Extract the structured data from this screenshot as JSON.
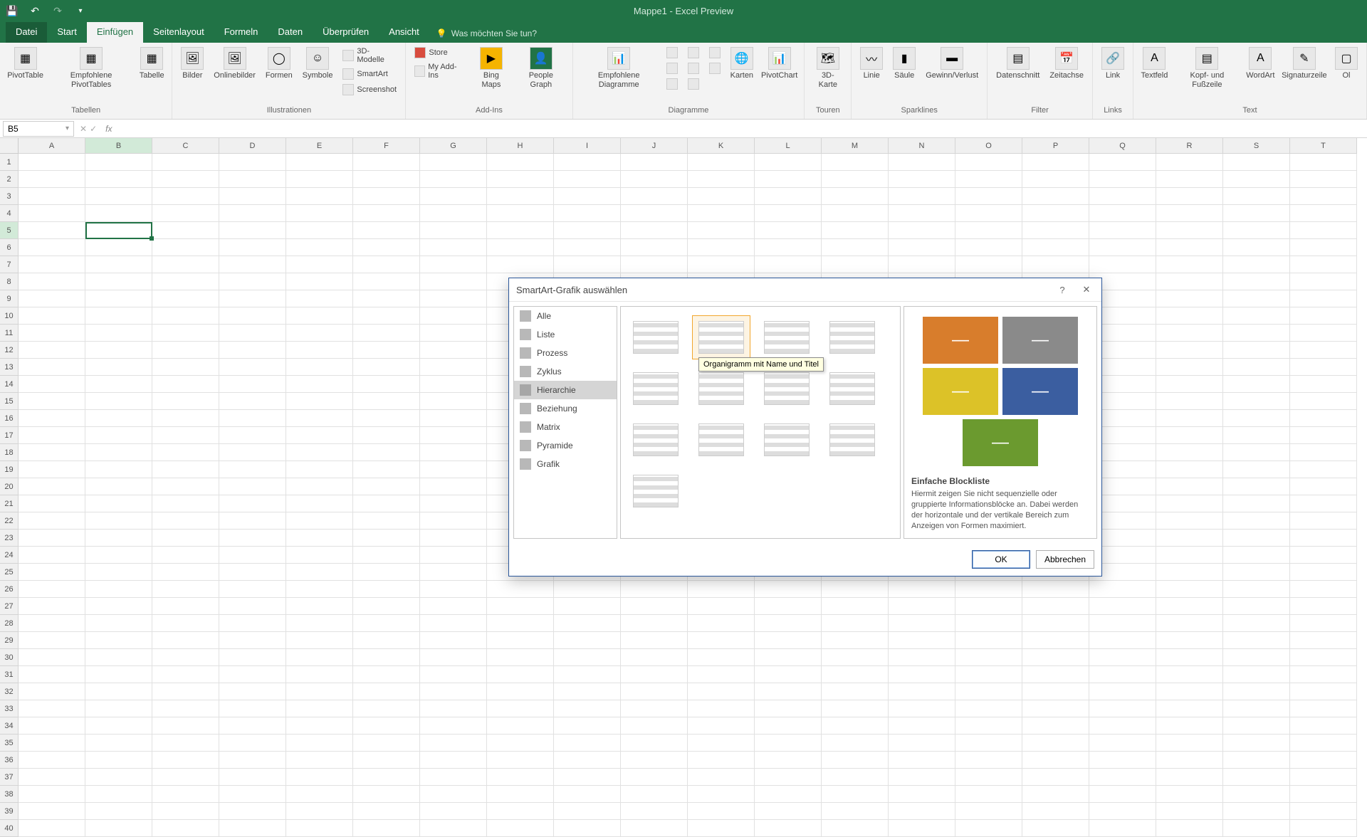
{
  "app": {
    "title": "Mappe1  -  Excel Preview"
  },
  "qat": {
    "save": "💾",
    "undo": "↶",
    "redo": "↷",
    "customize": "▾"
  },
  "tabs": {
    "file": "Datei",
    "start": "Start",
    "insert": "Einfügen",
    "pagelayout": "Seitenlayout",
    "formulas": "Formeln",
    "data": "Daten",
    "review": "Überprüfen",
    "view": "Ansicht",
    "tellme": "Was möchten Sie tun?"
  },
  "ribbon": {
    "tables": {
      "label": "Tabellen",
      "pivottable": "PivotTable",
      "recommended": "Empfohlene PivotTables",
      "table": "Tabelle"
    },
    "illustrations": {
      "label": "Illustrationen",
      "pictures": "Bilder",
      "online": "Onlinebilder",
      "shapes": "Formen",
      "icons": "Symbole",
      "models": "3D-Modelle",
      "smartart": "SmartArt",
      "screenshot": "Screenshot"
    },
    "addins": {
      "label": "Add-Ins",
      "store": "Store",
      "myaddins": "My Add-Ins",
      "bing": "Bing Maps",
      "people": "People Graph"
    },
    "charts": {
      "label": "Diagramme",
      "recommended": "Empfohlene Diagramme",
      "maps": "Karten",
      "pivotchart": "PivotChart"
    },
    "tours": {
      "label": "Touren",
      "map": "3D-Karte"
    },
    "sparklines": {
      "label": "Sparklines",
      "line": "Linie",
      "column": "Säule",
      "winloss": "Gewinn/Verlust"
    },
    "filters": {
      "label": "Filter",
      "slicer": "Datenschnitt",
      "timeline": "Zeitachse"
    },
    "links": {
      "label": "Links",
      "link": "Link"
    },
    "text": {
      "label": "Text",
      "textbox": "Textfeld",
      "header": "Kopf- und Fußzeile",
      "wordart": "WordArt",
      "sigline": "Signaturzeile",
      "obj": "Ol"
    }
  },
  "namebox": "B5",
  "columns": [
    "A",
    "B",
    "C",
    "D",
    "E",
    "F",
    "G",
    "H",
    "I",
    "J",
    "K",
    "L",
    "M",
    "N",
    "O",
    "P",
    "Q",
    "R",
    "S",
    "T"
  ],
  "dialog": {
    "title": "SmartArt-Grafik auswählen",
    "categories": [
      "Alle",
      "Liste",
      "Prozess",
      "Zyklus",
      "Hierarchie",
      "Beziehung",
      "Matrix",
      "Pyramide",
      "Grafik"
    ],
    "selected_category": "Hierarchie",
    "tooltip": "Organigramm mit Name und Titel",
    "preview": {
      "title": "Einfache Blockliste",
      "desc": "Hiermit zeigen Sie nicht sequenzielle oder gruppierte Informationsblöcke an. Dabei werden der horizontale und der vertikale Bereich zum Anzeigen von Formen maximiert.",
      "colors": [
        "#d87d2c",
        "#8a8a8a",
        "#dcc228",
        "#3b5ea0",
        "#6b9a2f"
      ]
    },
    "ok": "OK",
    "cancel": "Abbrechen"
  }
}
